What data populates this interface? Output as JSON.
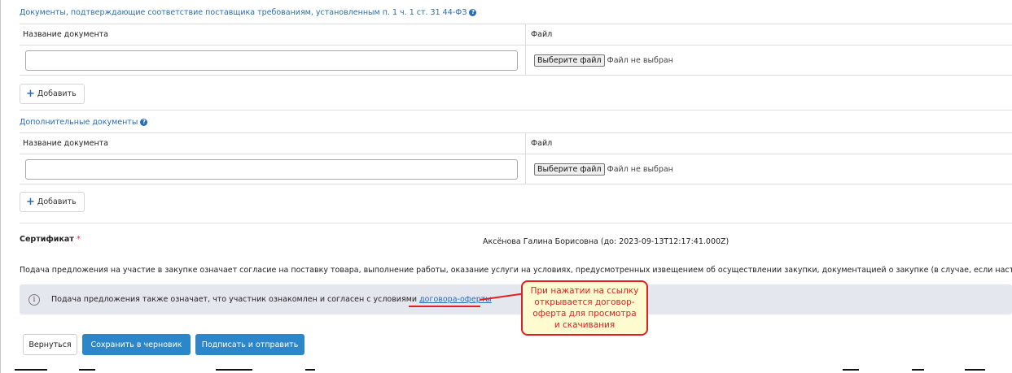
{
  "section1": {
    "title": "Документы, подтверждающие соответствие поставщика требованиям, установленным п. 1 ч. 1 ст. 31 44-ФЗ",
    "col_name": "Название документа",
    "col_file": "Файл",
    "file_button": "Выберите файл",
    "file_status": "Файл не выбран",
    "add_label": "Добавить"
  },
  "section2": {
    "title": "Дополнительные документы",
    "col_name": "Название документа",
    "col_file": "Файл",
    "file_button": "Выберите файл",
    "file_status": "Файл не выбран",
    "add_label": "Добавить"
  },
  "certificate": {
    "label": "Сертификат",
    "required_mark": "*",
    "value": "Аксёнова Галина Борисовна (до: 2023-09-13T12:17:41.000Z)"
  },
  "consent": {
    "text": "Подача предложения на участие в закупке означает согласие на поставку товара, выполнение работы, оказание услуги на условиях, предусмотренных извещением об осуществлении закупки, документацией о закупке (в случае, если настоящим"
  },
  "info": {
    "text": "Подача предложения также означает, что участник ознакомлен и согласен с условиями",
    "link": "договора-оферты"
  },
  "callout": {
    "text": "При нажатии на ссылку открывается договор-оферта для просмотра и скачивания"
  },
  "actions": {
    "back": "Вернуться",
    "save_draft": "Сохранить в черновик",
    "sign_send": "Подписать и отправить"
  },
  "colors": {
    "accent": "#2b87c9",
    "link": "#2a6db2",
    "annotation": "#e02020",
    "info_bg": "#e4e7ed"
  }
}
